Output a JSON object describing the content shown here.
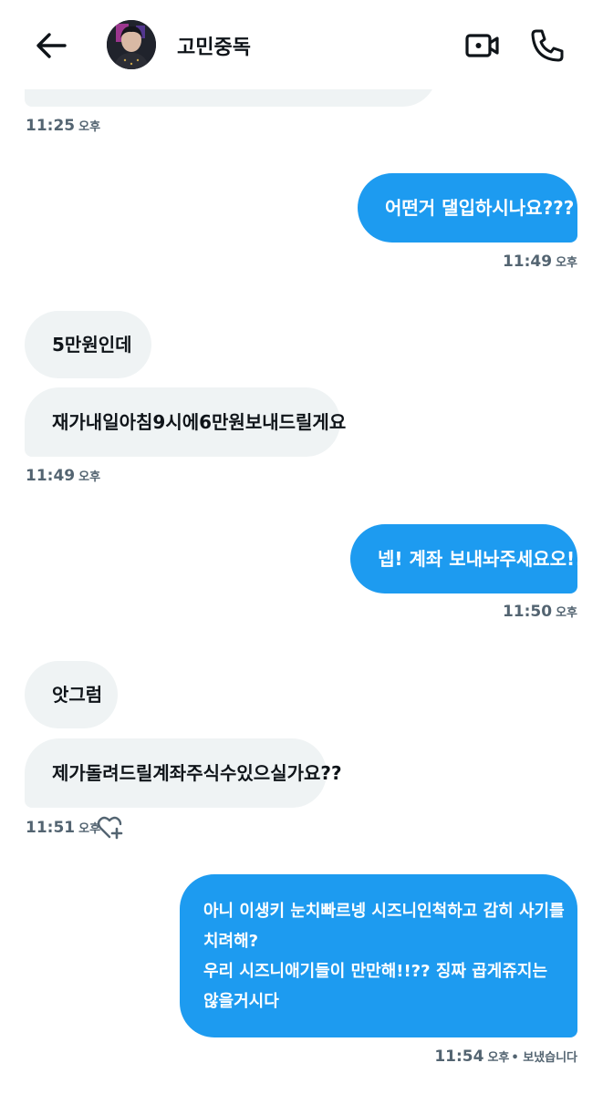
{
  "header": {
    "title": "고민중독",
    "back_icon": "arrow-left-icon",
    "video_icon": "video-camera-icon",
    "call_icon": "phone-icon"
  },
  "colors": {
    "incoming_bubble": "#eff3f4",
    "outgoing_bubble": "#1d9bf0",
    "timestamp": "#536471"
  },
  "messages": {
    "t1": {
      "time": "11:25",
      "ampm": "오후"
    },
    "m1": {
      "text": "어떤거 댈입하시나요???"
    },
    "t2": {
      "time": "11:49",
      "ampm": "오후"
    },
    "m2": {
      "text": "5만원인데"
    },
    "m3": {
      "text": "재가내일아침9시에6만원보내드릴게요"
    },
    "t3": {
      "time": "11:49",
      "ampm": "오후"
    },
    "m4": {
      "text": "넵! 계좌 보내놔주세요오!!"
    },
    "t4": {
      "time": "11:50",
      "ampm": "오후"
    },
    "m5": {
      "text": "앗그럼"
    },
    "m6": {
      "text": "제가돌려드릴계좌주식수있으실가요??"
    },
    "t5": {
      "time": "11:51",
      "ampm": "오후",
      "reaction_icon": "heart-plus-icon"
    },
    "m7": {
      "line1": "아니 이생키 눈치빠르넹 시즈니인척하고 감히 사기를",
      "line2": "치려해?",
      "line3": "우리 시즈니애기들이 만만해!!?? 징짜 곱게쥬지는",
      "line4": "않을거시다"
    },
    "t6": {
      "time": "11:54",
      "ampm": "오후",
      "status": "• 보냈습니다"
    }
  }
}
